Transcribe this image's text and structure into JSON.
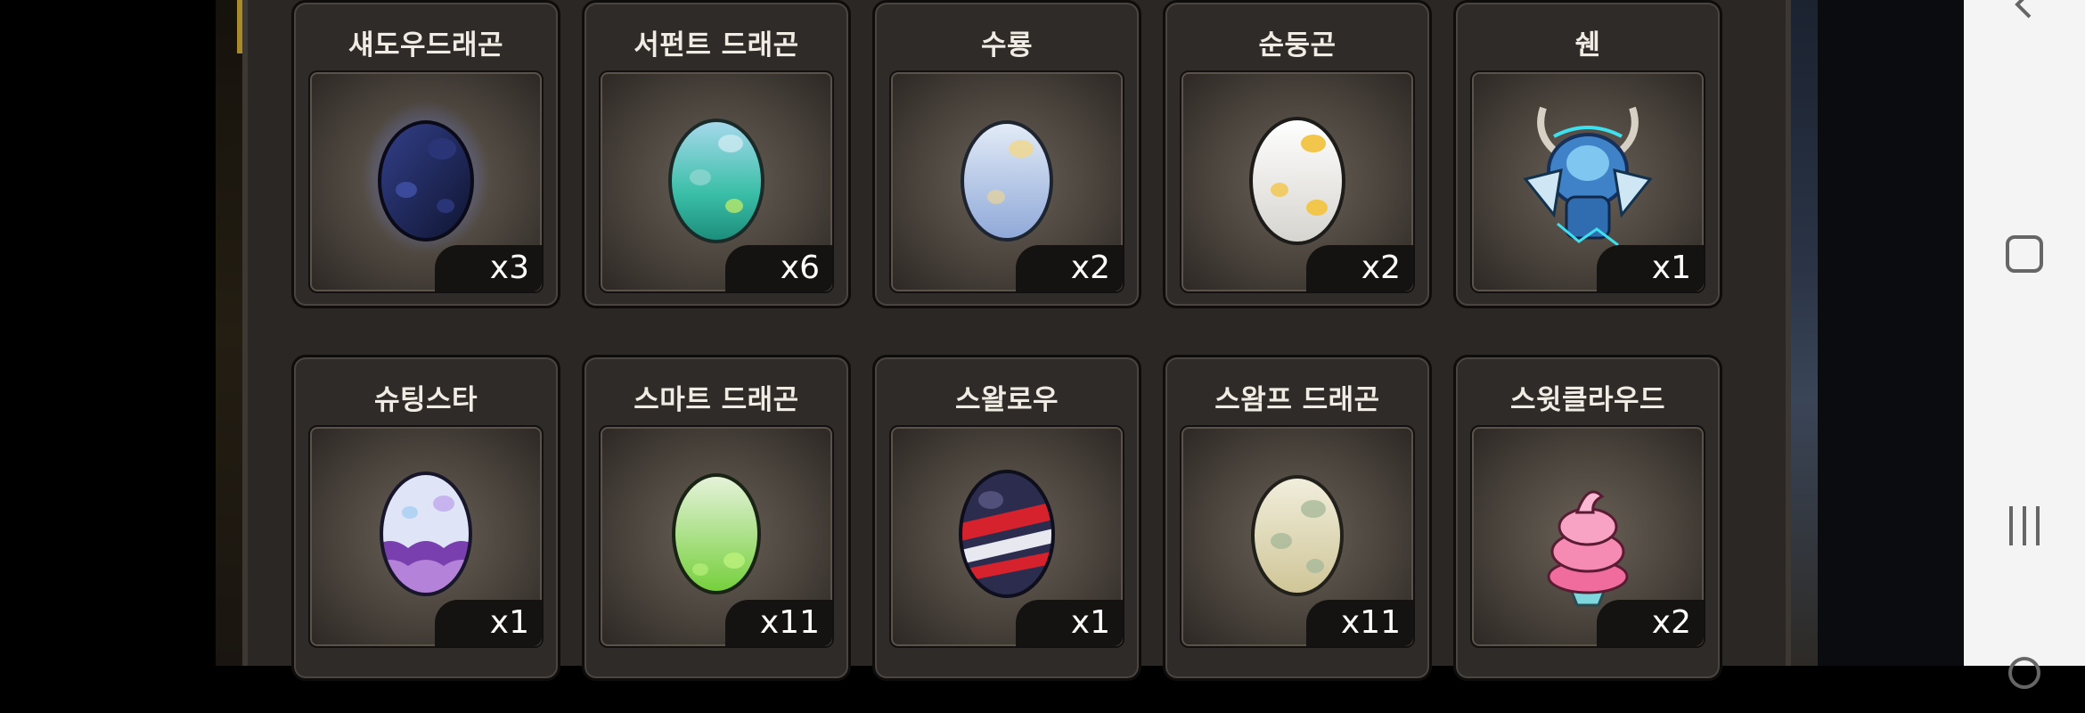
{
  "items": [
    {
      "name": "섀도우드래곤",
      "count": "x3",
      "icon": "egg-shadow-dragon"
    },
    {
      "name": "서펀트 드래곤",
      "count": "x6",
      "icon": "egg-serpent-dragon"
    },
    {
      "name": "수룡",
      "count": "x2",
      "icon": "egg-water-dragon"
    },
    {
      "name": "순둥곤",
      "count": "x2",
      "icon": "egg-gentle-dragon"
    },
    {
      "name": "쉔",
      "count": "x1",
      "icon": "shen-dragon-figure"
    },
    {
      "name": "슈팅스타",
      "count": "x1",
      "icon": "egg-shooting-star"
    },
    {
      "name": "스마트 드래곤",
      "count": "x11",
      "icon": "egg-smart-dragon"
    },
    {
      "name": "스왈로우",
      "count": "x1",
      "icon": "egg-swallow"
    },
    {
      "name": "스왐프 드래곤",
      "count": "x11",
      "icon": "egg-swamp-dragon"
    },
    {
      "name": "스윗클라우드",
      "count": "x2",
      "icon": "sweet-cloud-icecream"
    }
  ],
  "colors": {
    "panel": "#2b2724",
    "card_border": "#0f0d0c",
    "count_bg": "#151312",
    "text": "#f0ece4"
  }
}
